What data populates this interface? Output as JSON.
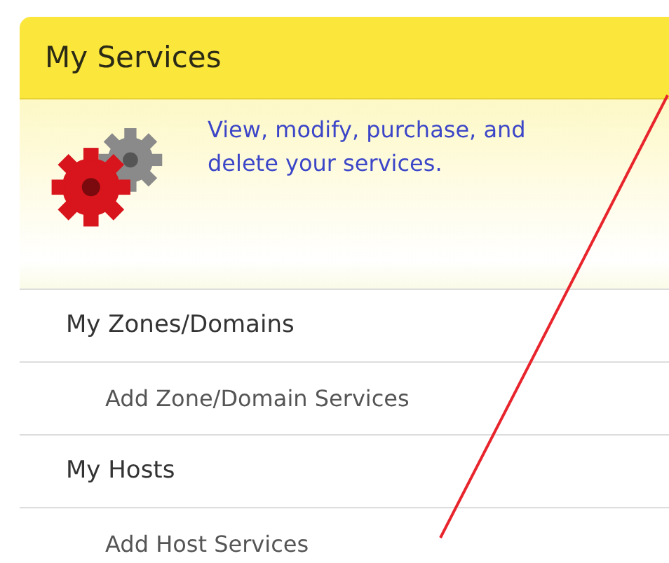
{
  "panel": {
    "title": "My Services",
    "description": "View, modify, purchase, and delete your services."
  },
  "menu": [
    {
      "label": "My Zones/Domains",
      "children": [
        {
          "label": "Add Zone/Domain Services"
        }
      ]
    },
    {
      "label": "My Hosts",
      "children": [
        {
          "label": "Add Host Services"
        }
      ]
    }
  ]
}
